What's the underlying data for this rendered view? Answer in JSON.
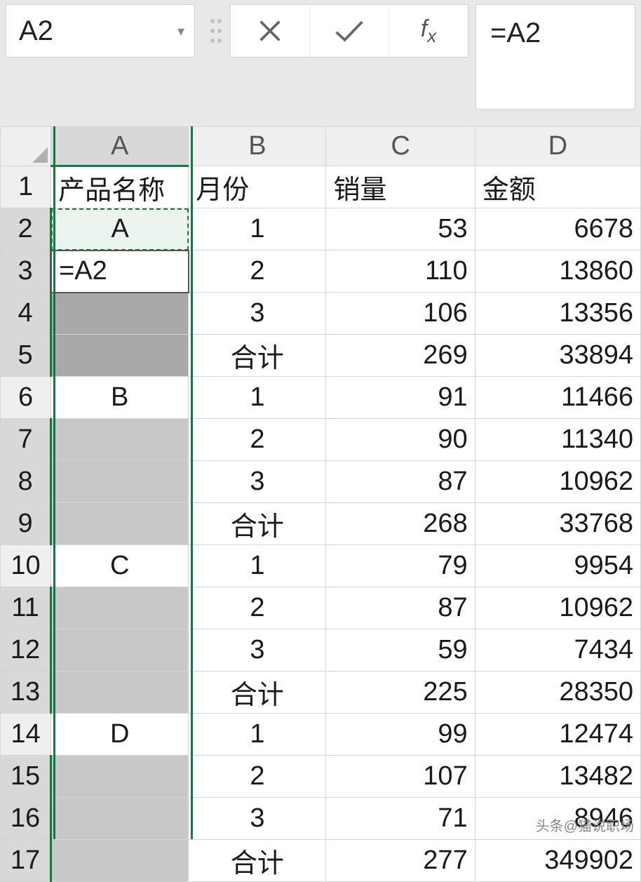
{
  "nameBox": "A2",
  "formula": "=A2",
  "columns": [
    "A",
    "B",
    "C",
    "D"
  ],
  "headers": {
    "A": "产品名称",
    "B": "月份",
    "C": "销量",
    "D": "金额"
  },
  "rows": [
    {
      "n": 1,
      "A": "产品名称",
      "B": "月份",
      "C": "销量",
      "D": "金额",
      "hdr": true
    },
    {
      "n": 2,
      "A": "A",
      "B": "1",
      "C": "53",
      "D": "6678",
      "march": true
    },
    {
      "n": 3,
      "A": "=A2",
      "B": "2",
      "C": "110",
      "D": "13860",
      "edit": true
    },
    {
      "n": 4,
      "A": "",
      "B": "3",
      "C": "106",
      "D": "13356",
      "blank": 1
    },
    {
      "n": 5,
      "A": "",
      "B": "合计",
      "C": "269",
      "D": "33894",
      "bold": true,
      "blank": 1
    },
    {
      "n": 6,
      "A": "B",
      "B": "1",
      "C": "91",
      "D": "11466"
    },
    {
      "n": 7,
      "A": "",
      "B": "2",
      "C": "90",
      "D": "11340",
      "blank": 2
    },
    {
      "n": 8,
      "A": "",
      "B": "3",
      "C": "87",
      "D": "10962",
      "blank": 2
    },
    {
      "n": 9,
      "A": "",
      "B": "合计",
      "C": "268",
      "D": "33768",
      "bold": true,
      "blank": 2
    },
    {
      "n": 10,
      "A": "C",
      "B": "1",
      "C": "79",
      "D": "9954"
    },
    {
      "n": 11,
      "A": "",
      "B": "2",
      "C": "87",
      "D": "10962",
      "blank": 2
    },
    {
      "n": 12,
      "A": "",
      "B": "3",
      "C": "59",
      "D": "7434",
      "blank": 2
    },
    {
      "n": 13,
      "A": "",
      "B": "合计",
      "C": "225",
      "D": "28350",
      "bold": true,
      "blank": 2
    },
    {
      "n": 14,
      "A": "D",
      "B": "1",
      "C": "99",
      "D": "12474"
    },
    {
      "n": 15,
      "A": "",
      "B": "2",
      "C": "107",
      "D": "13482",
      "blank": 2
    },
    {
      "n": 16,
      "A": "",
      "B": "3",
      "C": "71",
      "D": "8946",
      "blank": 2
    },
    {
      "n": 17,
      "A": "",
      "B": "合计",
      "C": "277",
      "D": "349902",
      "bold": true,
      "blank": 2
    }
  ],
  "watermark": "头条@猫说职场"
}
